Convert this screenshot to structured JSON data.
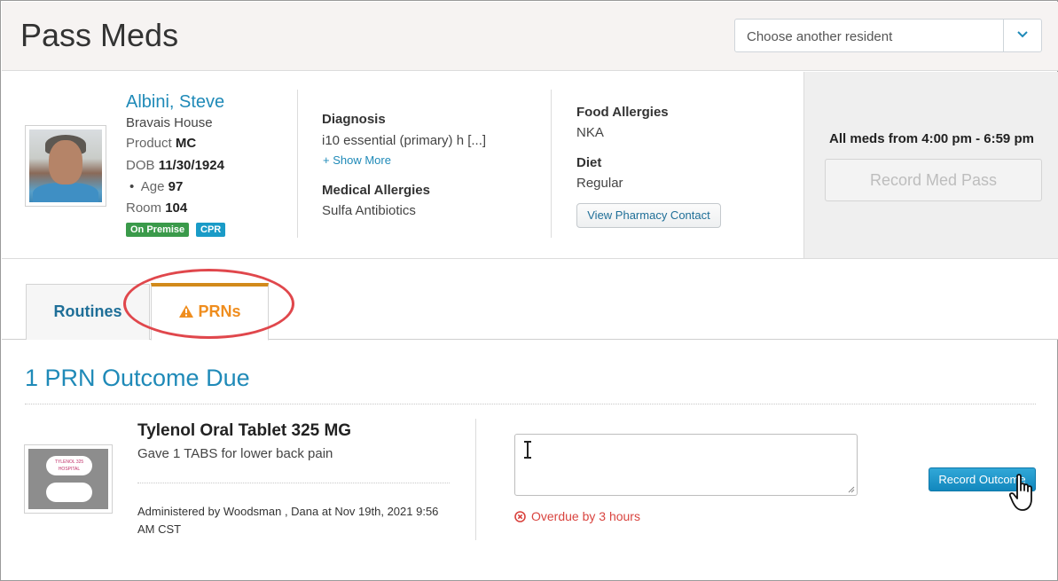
{
  "header": {
    "title": "Pass Meds",
    "resident_select_placeholder": "Choose another resident"
  },
  "resident": {
    "name": "Albini, Steve",
    "house": "Bravais House",
    "product_label": "Product",
    "product_value": "MC",
    "dob_label": "DOB",
    "dob_value": "11/30/1924",
    "age_bullet": "•",
    "age_label": "Age",
    "age_value": "97",
    "room_label": "Room",
    "room_value": "104",
    "badges": [
      "On Premise",
      "CPR"
    ]
  },
  "clinical": {
    "diagnosis_label": "Diagnosis",
    "diagnosis_value": "i10 essential (primary) h [...]",
    "show_more": "+ Show More",
    "medical_allergies_label": "Medical Allergies",
    "medical_allergies_value": "Sulfa Antibiotics",
    "food_allergies_label": "Food Allergies",
    "food_allergies_value": "NKA",
    "diet_label": "Diet",
    "diet_value": "Regular",
    "pharmacy_button": "View Pharmacy Contact"
  },
  "med_pass": {
    "window": "All meds from 4:00 pm - 6:59 pm",
    "record_button": "Record Med Pass"
  },
  "tabs": [
    {
      "label": "Routines",
      "active": false
    },
    {
      "label": "PRNs",
      "active": true,
      "icon": "warning-icon"
    }
  ],
  "section": {
    "title": "1 PRN Outcome Due"
  },
  "prn_item": {
    "name": "Tylenol Oral Tablet 325 MG",
    "reason": "Gave 1 TABS for lower back pain",
    "administered": "Administered by Woodsman , Dana at Nov 19th, 2021 9:56 AM CST",
    "thumb_text": "TYLENOL 325 HOSPITAL",
    "outcome_value": "",
    "overdue": "Overdue by 3 hours",
    "record_outcome_button": "Record Outcome"
  },
  "colors": {
    "accent": "#1f8ab8",
    "prn_tab": "#ef8d1e",
    "prn_tab_border": "#d28a1b",
    "highlight": "#e0474c",
    "overdue": "#d9443f",
    "badge_green": "#3a9a4a",
    "badge_blue": "#1a9bc7"
  }
}
